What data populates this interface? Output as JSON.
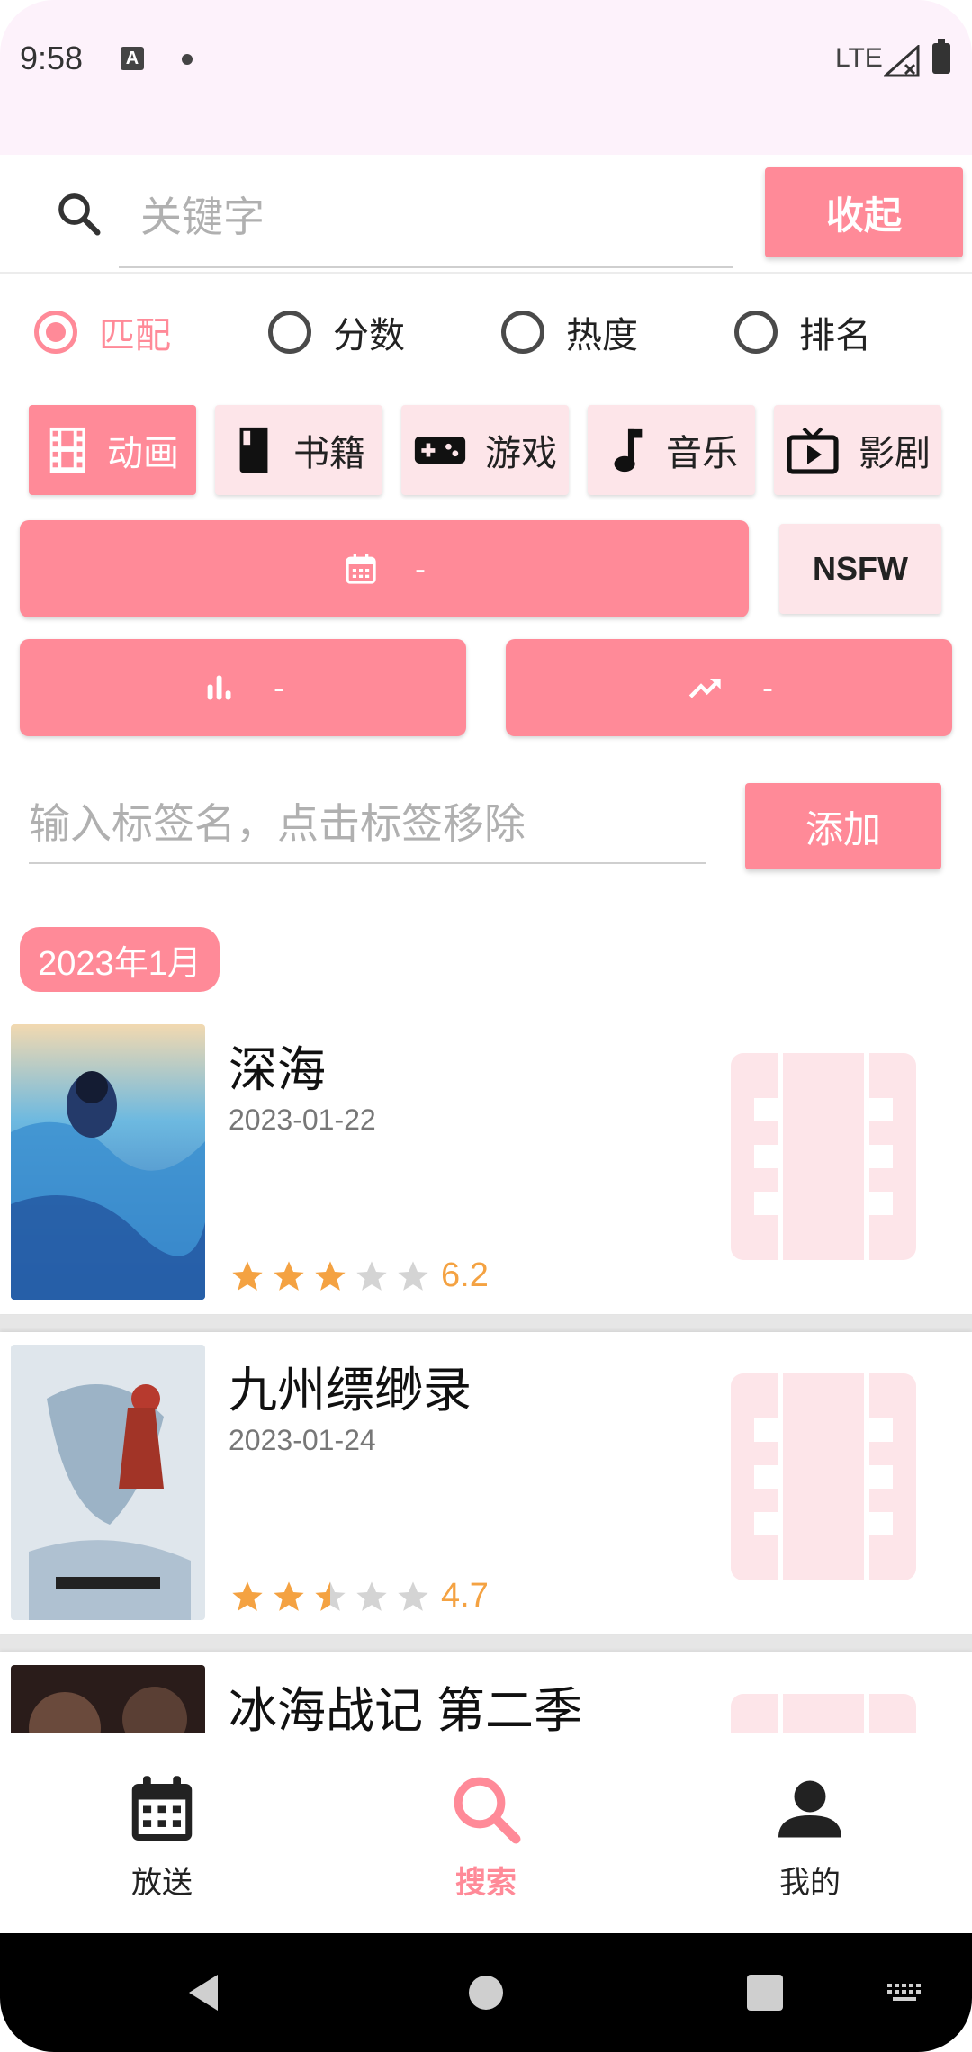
{
  "status_bar": {
    "time": "9:58",
    "network": "LTE"
  },
  "search": {
    "placeholder": "关键字",
    "collapse_label": "收起"
  },
  "sort_options": [
    {
      "label": "匹配",
      "selected": true
    },
    {
      "label": "分数",
      "selected": false
    },
    {
      "label": "热度",
      "selected": false
    },
    {
      "label": "排名",
      "selected": false
    }
  ],
  "categories": [
    {
      "label": "动画",
      "icon": "film-icon",
      "active": true
    },
    {
      "label": "书籍",
      "icon": "book-icon",
      "active": false
    },
    {
      "label": "游戏",
      "icon": "gamepad-icon",
      "active": false
    },
    {
      "label": "音乐",
      "icon": "music-note-icon",
      "active": false
    },
    {
      "label": "影剧",
      "icon": "tv-icon",
      "active": false
    }
  ],
  "filters": {
    "date_value": "-",
    "score_value": "-",
    "trend_value": "-",
    "nsfw_label": "NSFW"
  },
  "tags": {
    "placeholder": "输入标签名，点击标签移除",
    "add_label": "添加"
  },
  "month_chip": "2023年1月",
  "results": [
    {
      "title": "深海",
      "date": "2023-01-22",
      "rating": 6.2,
      "stars": [
        1,
        1,
        1,
        0,
        0
      ],
      "score_text": "6.2"
    },
    {
      "title": "九州缥缈录",
      "date": "2023-01-24",
      "rating": 4.7,
      "stars": [
        1,
        1,
        0.5,
        0,
        0
      ],
      "score_text": "4.7"
    },
    {
      "title": "冰海战记 第二季",
      "date": "",
      "rating": null,
      "stars": [],
      "score_text": ""
    }
  ],
  "bottom_nav": [
    {
      "label": "放送",
      "icon": "calendar-icon",
      "active": false
    },
    {
      "label": "搜索",
      "icon": "search-icon",
      "active": true
    },
    {
      "label": "我的",
      "icon": "person-icon",
      "active": false
    }
  ],
  "colors": {
    "accent": "#ff8a98",
    "chip_bg": "#fde5e9",
    "star": "#f4a242"
  }
}
